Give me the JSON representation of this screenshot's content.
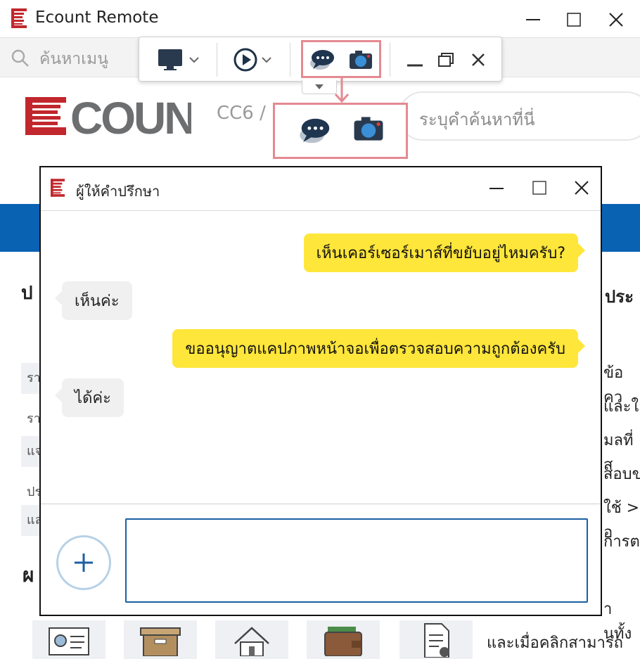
{
  "window": {
    "title": "Ecount Remote",
    "logo_icon": "ecount-e-icon",
    "controls": [
      "minimize-icon",
      "maximize-icon",
      "close-icon"
    ]
  },
  "menubar": {
    "search_placeholder": "ค้นหาเมนู",
    "icon": "search-icon"
  },
  "toolbar": {
    "items": [
      "monitor-icon",
      "play-icon",
      "chat-icon",
      "camera-icon",
      "minimize-icon",
      "restore-icon",
      "close-icon"
    ],
    "handle_icon": "caret-down-icon"
  },
  "page": {
    "company_partial": "CC6 / 6",
    "search_placeholder": "ระบุคำค้นหาที่นี่",
    "left_fragments": [
      "ป",
      "รา",
      "รา",
      "แจ",
      "ปร",
      "แล",
      "ผ"
    ],
    "right_heading": "ประ",
    "right_fragments": [
      "ข้อคว",
      "และใ",
      "มลที่ส",
      "สอบข",
      "ใช้ > อ",
      "การต",
      "านทั้ง",
      "และเมื่อคลิกสามารถ"
    ]
  },
  "chat": {
    "title": "ผู้ให้คำปรึกษา",
    "messages": [
      {
        "from": "me",
        "text": "เห็นเคอร์เซอร์เมาส์ที่ขยับอยู่ไหมครับ?"
      },
      {
        "from": "them",
        "text": "เห็นค่ะ"
      },
      {
        "from": "me",
        "text": "ขออนุญาตแคปภาพหน้าจอเพื่อตรวจสอบความถูกต้องครับ"
      },
      {
        "from": "them",
        "text": "ได้ค่ะ"
      }
    ],
    "input_value": "",
    "add_icon": "plus-icon"
  },
  "bottom_tiles": [
    "id-card-icon",
    "box-icon",
    "home-icon",
    "wallet-icon",
    "document-gear-icon"
  ],
  "colors": {
    "brand_red": "#c1272d",
    "brand_blue": "#0a62b3",
    "bubble_me": "#ffe63a",
    "bubble_them": "#f0f0f0",
    "highlight": "#e48a91"
  }
}
